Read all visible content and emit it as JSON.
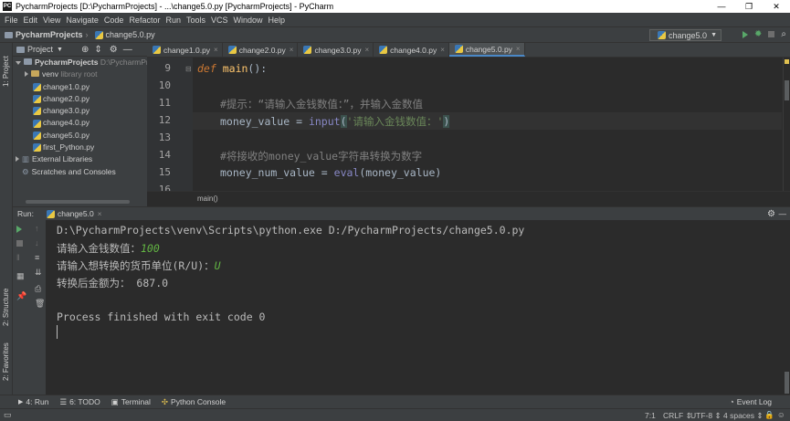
{
  "window": {
    "title": "PycharmProjects [D:\\PycharmProjects] - ...\\change5.0.py [PycharmProjects] - PyCharm",
    "app_icon": "PC",
    "controls": [
      "—",
      "❐",
      "✕"
    ]
  },
  "menu": [
    "File",
    "Edit",
    "View",
    "Navigate",
    "Code",
    "Refactor",
    "Run",
    "Tools",
    "VCS",
    "Window",
    "Help"
  ],
  "nav": {
    "project": "PycharmProjects",
    "file": "change5.0.py",
    "run_config": "change5.0"
  },
  "left_strip": {
    "project_label": "1: Project",
    "structure_label": "2: Structure",
    "favorites_label": "2: Favorites"
  },
  "project_panel": {
    "header": "Project",
    "root_name": "PycharmProjects",
    "root_path": "D:\\PycharmProjects",
    "venv_name": "venv",
    "venv_note": "library root",
    "files": [
      "change1.0.py",
      "change2.0.py",
      "change3.0.py",
      "change4.0.py",
      "change5.0.py",
      "first_Python.py"
    ],
    "external": "External Libraries",
    "scratches": "Scratches and Consoles"
  },
  "tabs": [
    {
      "label": "change1.0.py",
      "active": false
    },
    {
      "label": "change2.0.py",
      "active": false
    },
    {
      "label": "change3.0.py",
      "active": false
    },
    {
      "label": "change4.0.py",
      "active": false
    },
    {
      "label": "change5.0.py",
      "active": true
    }
  ],
  "editor": {
    "line_numbers": [
      "9",
      "10",
      "11",
      "12",
      "13",
      "14",
      "15",
      "16"
    ],
    "l9_kw": "def",
    "l9_fn": "main",
    "l9_rest": "():",
    "l11": "#提示：“请输入金钱数值：”，并输入金数值",
    "l12_var": "money_value",
    "l12_eq": " = ",
    "l12_bi": "input",
    "l12_paren": "(",
    "l12_str": "'请输入金钱数值：'",
    "l12_close": ")",
    "l14": "#将接收的money_value字符串转换为数字",
    "l15_var": "money_num_value",
    "l15_eq": " = ",
    "l15_bi": "eval",
    "l15_rest": "(money_value)",
    "breadcrumb": "main()"
  },
  "run_panel": {
    "label": "Run:",
    "config": "change5.0",
    "lines": [
      "D:\\PycharmProjects\\venv\\Scripts\\python.exe D:/PycharmProjects/change5.0.py",
      "请输入金钱数值：",
      "请输入想转换的货币单位(R/U)：",
      "转换后金额为： 687.0",
      "Process finished with exit code 0"
    ],
    "input1": "100",
    "input2": "U"
  },
  "tool_windows": [
    "4: Run",
    "6: TODO",
    "Terminal",
    "Python Console"
  ],
  "event_log": "Event Log",
  "status": {
    "pos": "7:1",
    "line_sep": "CRLF",
    "encoding": "UTF-8",
    "indent": "4 spaces"
  },
  "colors": {
    "accent": "#4a88c7",
    "run_green": "#59a869",
    "input_green": "#62b543"
  }
}
